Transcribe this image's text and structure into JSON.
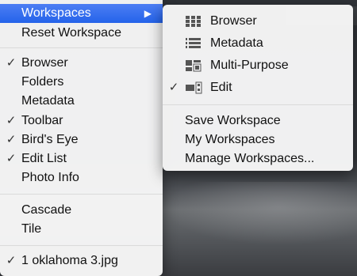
{
  "main_menu": {
    "workspaces": {
      "label": "Workspaces",
      "arrow": "▶"
    },
    "reset_workspace": {
      "label": "Reset Workspace"
    },
    "panels": [
      {
        "label": "Browser",
        "checked": true
      },
      {
        "label": "Folders",
        "checked": false
      },
      {
        "label": "Metadata",
        "checked": false
      },
      {
        "label": "Toolbar",
        "checked": true
      },
      {
        "label": "Bird's Eye",
        "checked": true
      },
      {
        "label": "Edit List",
        "checked": true
      },
      {
        "label": "Photo Info",
        "checked": false
      }
    ],
    "arrange": [
      {
        "label": "Cascade"
      },
      {
        "label": "Tile"
      }
    ],
    "window": {
      "label": "1 oklahoma 3.jpg",
      "checked": true
    },
    "check_glyph": "✓"
  },
  "sub_menu": {
    "workspaces": [
      {
        "label": "Browser",
        "icon": "browser-grid-icon",
        "checked": false
      },
      {
        "label": "Metadata",
        "icon": "metadata-list-icon",
        "checked": false
      },
      {
        "label": "Multi-Purpose",
        "icon": "multi-purpose-icon",
        "checked": false
      },
      {
        "label": "Edit",
        "icon": "edit-workspace-icon",
        "checked": true
      }
    ],
    "actions": [
      {
        "label": "Save Workspace"
      },
      {
        "label": "My Workspaces"
      },
      {
        "label": "Manage Workspaces..."
      }
    ],
    "check_glyph": "✓"
  },
  "colors": {
    "highlight": "#2463ea",
    "menu_bg": "#f7f7f7",
    "separator": "#dadada"
  }
}
